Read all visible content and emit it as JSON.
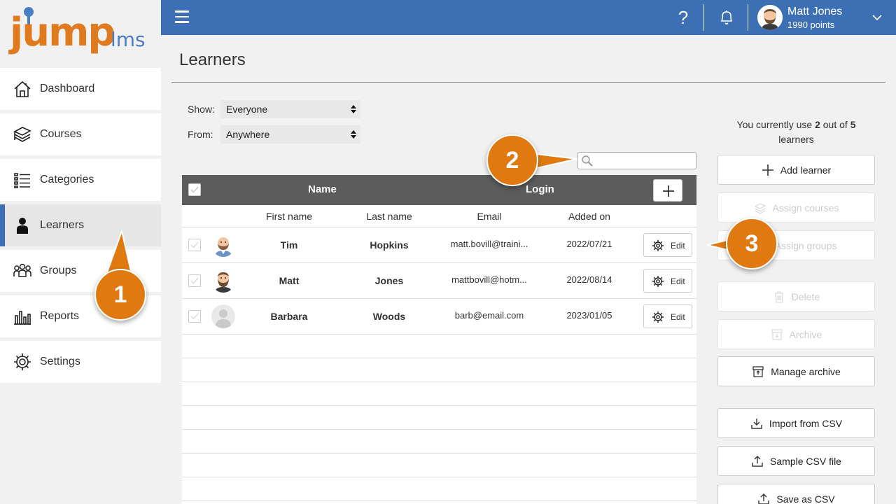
{
  "brand": {
    "logo_main": "jump",
    "logo_sub": "lms"
  },
  "sidebar": {
    "items": [
      {
        "label": "Dashboard",
        "icon": "home-icon"
      },
      {
        "label": "Courses",
        "icon": "books-icon"
      },
      {
        "label": "Categories",
        "icon": "list-icon"
      },
      {
        "label": "Learners",
        "icon": "person-icon",
        "active": true
      },
      {
        "label": "Groups",
        "icon": "group-icon"
      },
      {
        "label": "Reports",
        "icon": "bar-chart-icon"
      },
      {
        "label": "Settings",
        "icon": "gear-icon"
      }
    ]
  },
  "topbar": {
    "help": "?",
    "user_name": "Matt Jones",
    "user_points": "1990 points"
  },
  "page": {
    "title": "Learners"
  },
  "filters": {
    "show_label": "Show:",
    "show_value": "Everyone",
    "from_label": "From:",
    "from_value": "Anywhere"
  },
  "search": {
    "placeholder": ""
  },
  "table": {
    "group_headers": {
      "name": "Name",
      "login": "Login"
    },
    "columns": [
      "First name",
      "Last name",
      "Email",
      "Added on"
    ],
    "edit_label": "Edit",
    "rows": [
      {
        "first": "Tim",
        "last": "Hopkins",
        "email": "matt.bovill@traini...",
        "added": "2022/07/21",
        "avatar": "bald-man"
      },
      {
        "first": "Matt",
        "last": "Jones",
        "email": "mattbovill@hotm...",
        "added": "2022/08/14",
        "avatar": "bearded-man"
      },
      {
        "first": "Barbara",
        "last": "Woods",
        "email": "barb@email.com",
        "added": "2023/01/05",
        "avatar": "placeholder"
      }
    ]
  },
  "usage": {
    "prefix": "You currently use ",
    "used": "2",
    "middle": " out of ",
    "total": "5",
    "suffix": " learners"
  },
  "actions": [
    {
      "label": "Add learner",
      "enabled": true
    },
    {
      "label": "Assign courses",
      "enabled": false
    },
    {
      "label": "Assign groups",
      "enabled": false
    },
    {
      "label": "Delete",
      "enabled": false
    },
    {
      "label": "Archive",
      "enabled": false
    },
    {
      "label": "Manage archive",
      "enabled": true
    },
    {
      "label": "Import from CSV",
      "enabled": true
    },
    {
      "label": "Sample CSV file",
      "enabled": true
    },
    {
      "label": "Save as CSV",
      "enabled": true
    }
  ],
  "callouts": [
    "1",
    "2",
    "3"
  ],
  "colors": {
    "brand_blue": "#3d6fb5",
    "brand_orange": "#e07a1f",
    "callout": "#e07a10"
  }
}
